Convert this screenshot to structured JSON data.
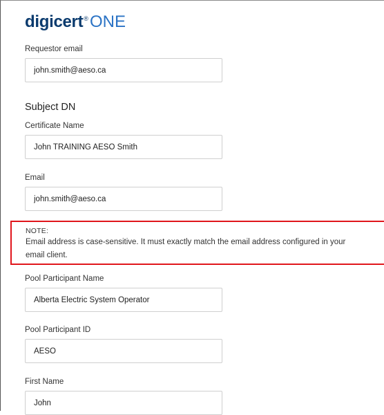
{
  "logo": {
    "brand": "digicert",
    "mark": "®",
    "product": "ONE"
  },
  "form": {
    "requestor_email": {
      "label": "Requestor email",
      "value": "john.smith@aeso.ca"
    },
    "subject_dn": {
      "heading": "Subject DN"
    },
    "certificate_name": {
      "label": "Certificate Name",
      "value": "John TRAINING AESO Smith"
    },
    "email": {
      "label": "Email",
      "value": "john.smith@aeso.ca"
    },
    "note": {
      "title": "NOTE:",
      "text": "Email address is case-sensitive. It must exactly match the email address configured in your email client."
    },
    "pool_participant_name": {
      "label": "Pool Participant Name",
      "value": "Alberta Electric System Operator"
    },
    "pool_participant_id": {
      "label": "Pool Participant ID",
      "value": "AESO"
    },
    "first_name": {
      "label": "First Name",
      "value": "John"
    }
  }
}
